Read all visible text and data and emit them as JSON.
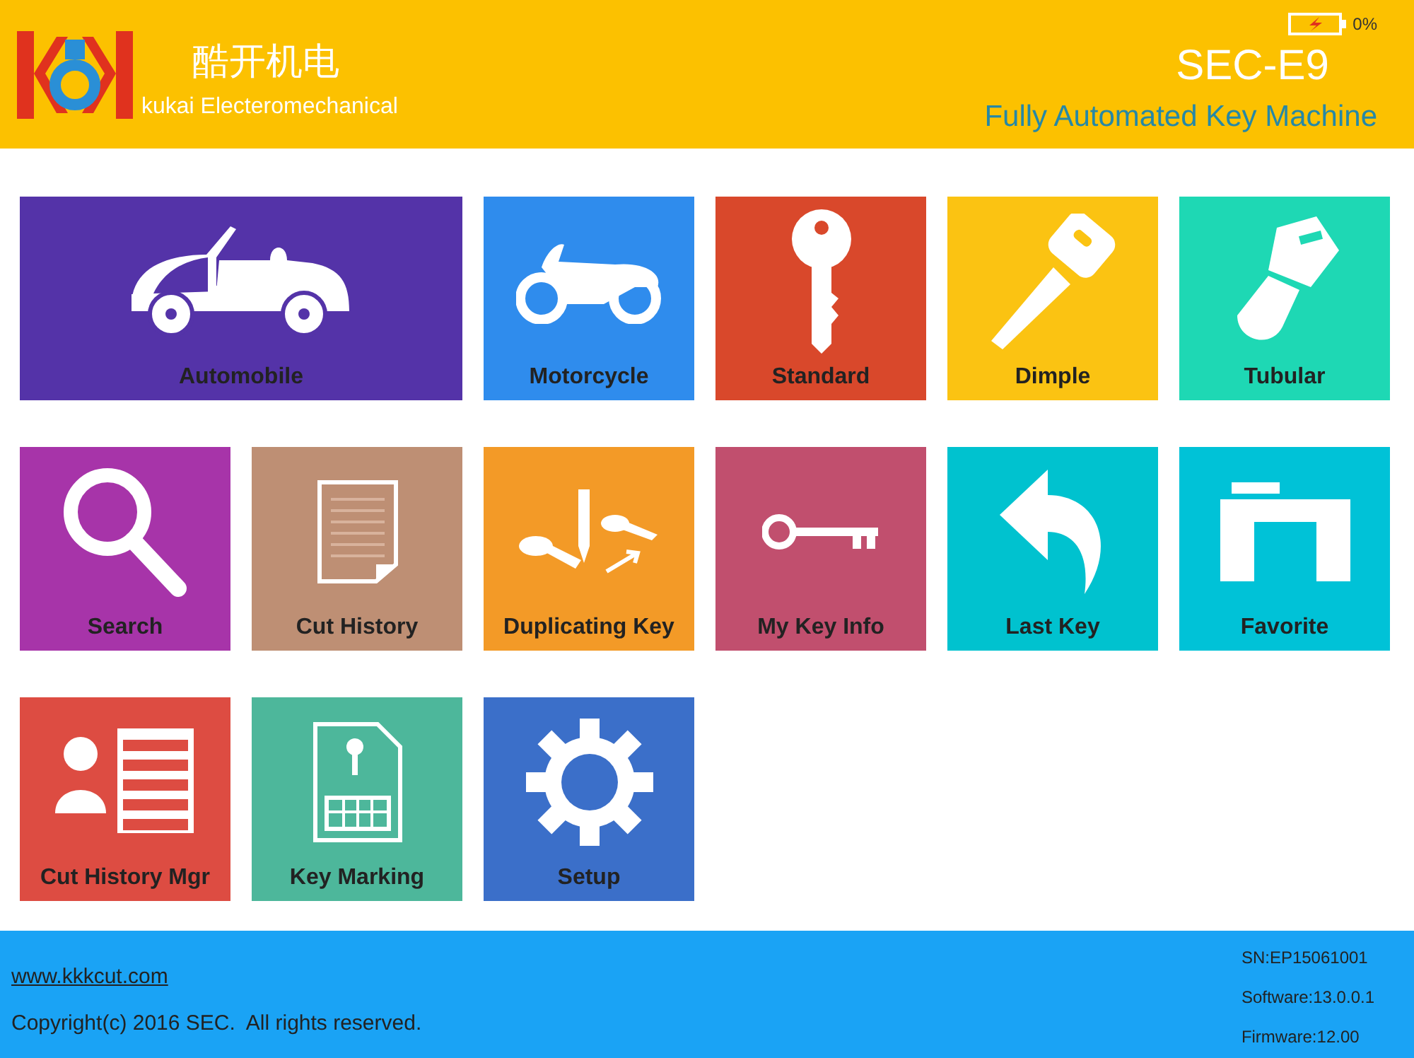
{
  "header": {
    "brand_cn": "酷开机电",
    "brand_en": "kukai Electeromechanical",
    "battery": "0%",
    "model": "SEC-E9",
    "subtitle": "Fully Automated Key Machine"
  },
  "tiles": [
    {
      "label": "Automobile",
      "kind": "car",
      "color": "#5433a8",
      "wide": true
    },
    {
      "label": "Motorcycle",
      "kind": "motorcycle",
      "color": "#2f8ced",
      "wide": false
    },
    {
      "label": "Standard",
      "kind": "key",
      "color": "#d9482b",
      "wide": false
    },
    {
      "label": "Dimple",
      "kind": "dimple",
      "color": "#fbc312",
      "wide": false
    },
    {
      "label": "Tubular",
      "kind": "tubular",
      "color": "#1ed8b4",
      "wide": false
    },
    {
      "label": "Search",
      "kind": "search",
      "color": "#a734a9",
      "wide": false
    },
    {
      "label": "Cut History",
      "kind": "document",
      "color": "#be8f74",
      "wide": false
    },
    {
      "label": "Duplicating Key",
      "kind": "duplicate",
      "color": "#f39a27",
      "wide": false
    },
    {
      "label": "My Key Info",
      "kind": "oldkey",
      "color": "#c14f6e",
      "wide": false
    },
    {
      "label": "Last Key",
      "kind": "back",
      "color": "#00c2cf",
      "wide": false
    },
    {
      "label": "Favorite",
      "kind": "folder",
      "color": "#00c2d7",
      "wide": false
    },
    {
      "label": "Cut History Mgr",
      "kind": "contact",
      "color": "#dd4c42",
      "wide": false
    },
    {
      "label": "Key Marking",
      "kind": "card",
      "color": "#4db79b",
      "wide": false
    },
    {
      "label": "Setup",
      "kind": "gear",
      "color": "#3b6fc9",
      "wide": false
    }
  ],
  "footer": {
    "link": "www.kkkcut.com",
    "copyright": "Copyright(c) 2016 SEC.  All rights reserved.",
    "serial": "SN:EP15061001",
    "software": "Software:13.0.0.1",
    "firmware": "Firmware:12.00"
  }
}
